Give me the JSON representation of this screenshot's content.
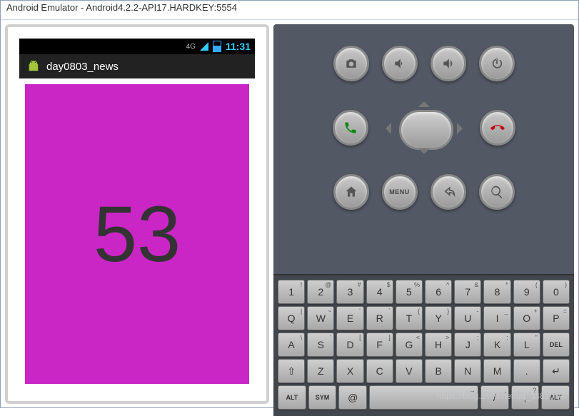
{
  "window": {
    "title": "Android Emulator - Android4.2.2-API17.HARDKEY:5554"
  },
  "status": {
    "signal": "4G",
    "clock": "11:31"
  },
  "app": {
    "title": "day0803_news",
    "content_number": "53"
  },
  "hw": {
    "row1": [
      "camera",
      "vol-down",
      "vol-up",
      "power"
    ],
    "row3": [
      "home",
      "menu",
      "back",
      "search"
    ]
  },
  "keyboard": {
    "r1": [
      {
        "m": "1",
        "s": "!"
      },
      {
        "m": "2",
        "s": "@"
      },
      {
        "m": "3",
        "s": "#"
      },
      {
        "m": "4",
        "s": "$"
      },
      {
        "m": "5",
        "s": "%"
      },
      {
        "m": "6",
        "s": "^"
      },
      {
        "m": "7",
        "s": "&"
      },
      {
        "m": "8",
        "s": "*"
      },
      {
        "m": "9",
        "s": "("
      },
      {
        "m": "0",
        "s": ")"
      }
    ],
    "r2": [
      {
        "m": "Q",
        "s": "|"
      },
      {
        "m": "W",
        "s": "~"
      },
      {
        "m": "E",
        "s": "¨"
      },
      {
        "m": "R",
        "s": "`"
      },
      {
        "m": "T",
        "s": "{"
      },
      {
        "m": "Y",
        "s": "}"
      },
      {
        "m": "U",
        "s": "-"
      },
      {
        "m": "I",
        "s": "_"
      },
      {
        "m": "O",
        "s": "+"
      },
      {
        "m": "P",
        "s": "="
      }
    ],
    "r3": [
      {
        "m": "A",
        "s": "\\"
      },
      {
        "m": "S",
        "s": "'"
      },
      {
        "m": "D",
        "s": "["
      },
      {
        "m": "F",
        "s": "]"
      },
      {
        "m": "G",
        "s": "<"
      },
      {
        "m": "H",
        "s": ">"
      },
      {
        "m": "J",
        "s": ";"
      },
      {
        "m": "K",
        "s": ":"
      },
      {
        "m": "L",
        "s": "\""
      },
      {
        "m": "DEL",
        "s": ""
      }
    ],
    "r4": [
      {
        "m": "⇧",
        "s": ""
      },
      {
        "m": "Z",
        "s": ""
      },
      {
        "m": "X",
        "s": ""
      },
      {
        "m": "C",
        "s": ""
      },
      {
        "m": "V",
        "s": ""
      },
      {
        "m": "B",
        "s": ""
      },
      {
        "m": "N",
        "s": ""
      },
      {
        "m": "M",
        "s": ""
      },
      {
        "m": ".",
        "s": ""
      },
      {
        "m": "↵",
        "s": ""
      }
    ],
    "r5": [
      {
        "m": "ALT",
        "s": "",
        "cls": "small"
      },
      {
        "m": "SYM",
        "s": "",
        "cls": "small"
      },
      {
        "m": "@",
        "s": ""
      },
      {
        "m": "",
        "s": "→",
        "cls": "space"
      },
      {
        "m": "/",
        "s": ","
      },
      {
        "m": ",",
        "s": "?"
      },
      {
        "m": "ALT",
        "s": "",
        "cls": "small"
      }
    ]
  },
  "watermark": "https://blog.csdn.net/qq_34810707"
}
